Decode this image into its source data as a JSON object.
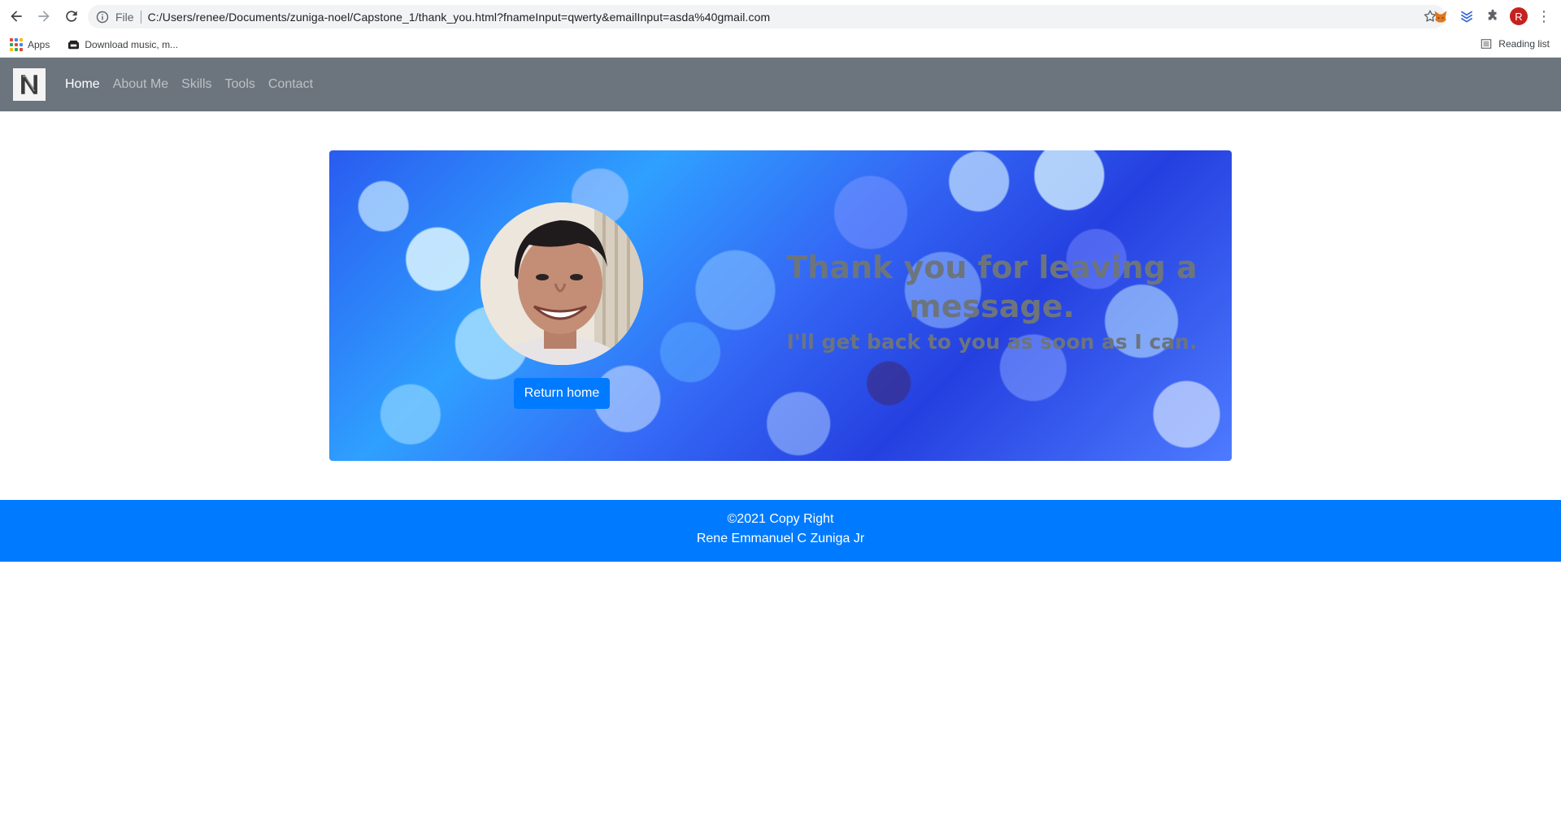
{
  "browser": {
    "url_scheme_label": "File",
    "url": "C:/Users/renee/Documents/zuniga-noel/Capstone_1/thank_you.html?fnameInput=qwerty&emailInput=asda%40gmail.com",
    "profile_initial": "R",
    "bookmarks": [
      {
        "label": "Apps",
        "icon": "apps-grid-icon"
      },
      {
        "label": "Download music, m...",
        "icon": "bookmark-favicon"
      }
    ],
    "reading_list_label": "Reading list"
  },
  "site": {
    "brand_icon": "logo-N-icon",
    "nav": [
      {
        "label": "Home",
        "active": true
      },
      {
        "label": "About Me"
      },
      {
        "label": "Skills"
      },
      {
        "label": "Tools"
      },
      {
        "label": "Contact"
      }
    ],
    "hero": {
      "title": "Thank you for leaving a message.",
      "subtitle": "I'll get back to you as soon as I can.",
      "button_label": "Return home"
    },
    "footer": {
      "line1": "©2021 Copy Right",
      "line2": "Rene Emmanuel C Zuniga Jr"
    }
  },
  "colors": {
    "navbar": "#6c757d",
    "primary": "#007bff",
    "hero_text": "#6c757d"
  }
}
